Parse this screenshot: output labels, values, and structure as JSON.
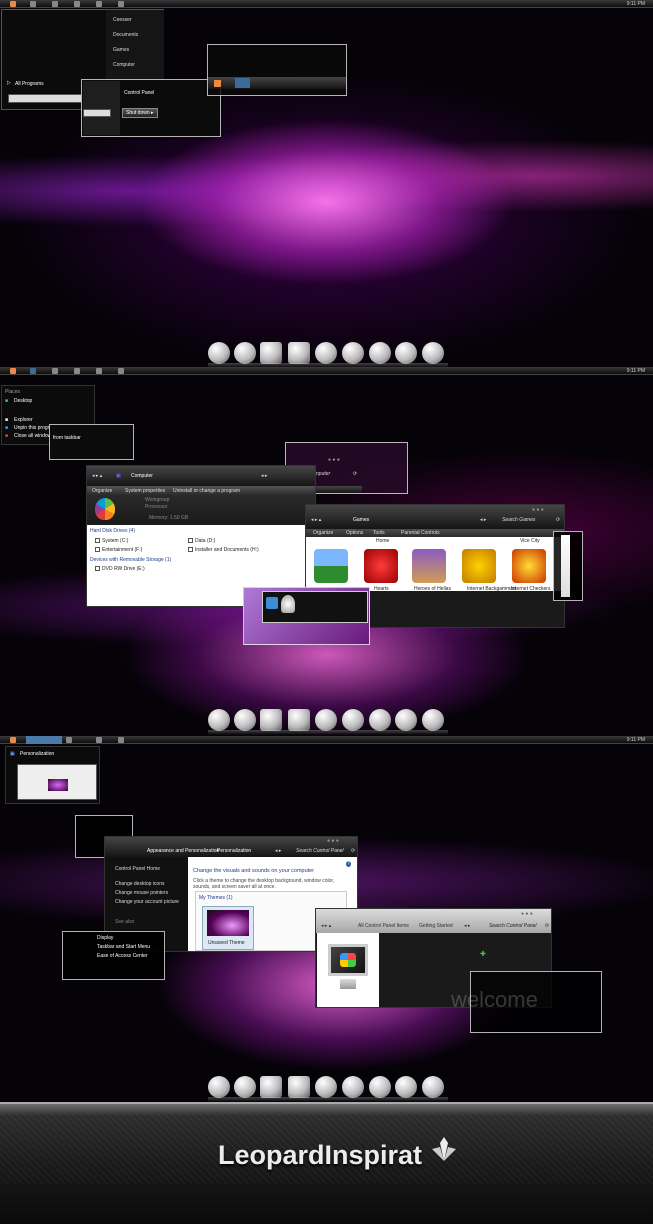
{
  "panel1": {
    "clock": "9:11 PM",
    "start_menu": {
      "items": [
        "Ceesser",
        "Documents",
        "Games",
        "Computer"
      ],
      "all_programs": "All Programs",
      "control_panel": "Control Panel",
      "shut_down": "Shut down"
    }
  },
  "panel2": {
    "clock": "9:11 PM",
    "jumplist": {
      "title": "Places",
      "items": [
        "Desktop",
        "Explorer",
        "Unpin this program",
        "Close all windows"
      ],
      "from_taskbar": "from taskbar"
    },
    "computer_window": {
      "address": "Computer",
      "toolbar": [
        "Organize",
        "System properties",
        "Uninstall or change a program"
      ],
      "info": [
        "Workgroup",
        "Processor",
        "Memory: 1.50 GB"
      ],
      "hard_disks_header": "Hard Disk Drives (4)",
      "disks": [
        "System (C:)",
        "Data (D:)",
        "Entertainment (F:)",
        "Installer and Documents (H:)"
      ],
      "removable_header": "Devices with Removable Storage (1)",
      "removable": [
        "DVD RW Drive (E:)"
      ]
    },
    "search_popup": "Search Computer",
    "games_window": {
      "address": "Games",
      "search": "Search Games",
      "toolbar": [
        "Organize",
        "Options",
        "Tools",
        "Parental Controls"
      ],
      "labels": [
        "Home",
        "Vice City"
      ],
      "games": [
        "Hearts",
        "Heroes of Hellas",
        "Internet Backgammon",
        "Internet Checkers"
      ]
    }
  },
  "panel3": {
    "clock": "9:11 PM",
    "thumb_title": "Personalization",
    "control_panel": {
      "breadcrumb": [
        "Appearance and Personalization",
        "Personalization"
      ],
      "search": "Search Control Panel",
      "home": "Control Panel Home",
      "links": [
        "Change desktop icons",
        "Change mouse pointers",
        "Change your account picture"
      ],
      "see_also": "See also",
      "see_also_items": [
        "Display",
        "Taskbar and Start Menu",
        "Ease of Access Center"
      ],
      "heading": "Change the visuals and sounds on your computer",
      "description": "Click a theme to change the desktop background, window color, sounds, and screen saver all at once.",
      "my_themes": "My Themes (1)",
      "unsaved_theme": "Unsaved Theme"
    },
    "getting_started": {
      "breadcrumb": [
        "All Control Panel Items",
        "Getting Started"
      ],
      "search": "Search Control Panel",
      "watermark": "welcome"
    }
  },
  "banner": {
    "brand": "LeopardInspirat"
  },
  "colors": {
    "accent": "#ff6ee6",
    "purple": "#8a1fb0",
    "link_blue": "#1c3a8a"
  }
}
